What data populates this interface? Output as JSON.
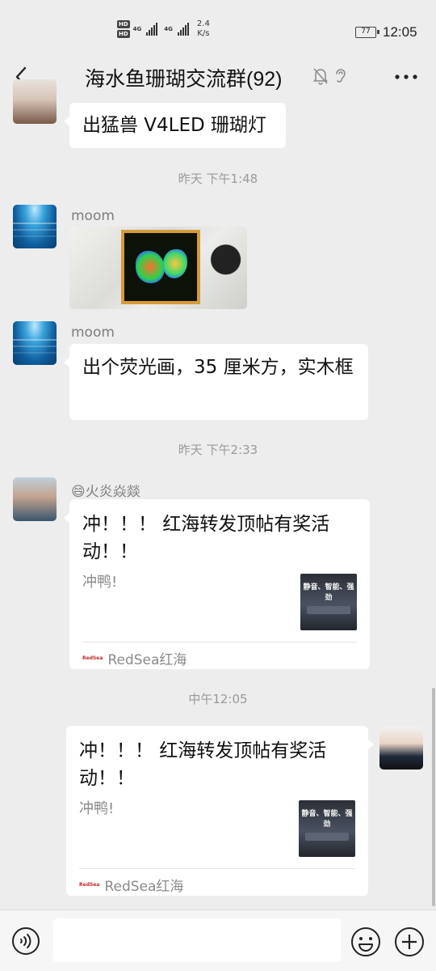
{
  "status_bar": {
    "hd1": "HD",
    "hd2": "HD",
    "sig1_label": "4G",
    "sig2_label": "4G",
    "speed_value": "2.4",
    "speed_unit": "K/s",
    "battery": "77",
    "time": "12:05"
  },
  "header": {
    "title": "海水鱼珊瑚交流群(92)"
  },
  "messages": {
    "m1_text": "出猛兽 V4LED 珊瑚灯",
    "time1": "昨天 下午1:48",
    "m2_sender": "moom",
    "m3_sender": "moom",
    "m3_text": "出个荧光画，35 厘米方，实木框",
    "time2": "昨天 下午2:33",
    "m4_sender": "😄火炎焱燚",
    "m4_card_title": "冲！！！ 红海转发顶帖有奖活动！！",
    "m4_card_desc": "冲鸭!",
    "m4_thumb_text": "静音、智能、强劲",
    "m4_source_logo": "RedSea",
    "m4_source": "RedSea红海",
    "time3": "中午12:05",
    "m5_card_title": "冲！！！ 红海转发顶帖有奖活动！！",
    "m5_card_desc": "冲鸭!",
    "m5_thumb_text": "静音、智能、强劲",
    "m5_source_logo": "RedSea",
    "m5_source": "RedSea红海"
  },
  "colors": {
    "background": "#ededed",
    "bubble": "#ffffff",
    "accent_red": "#c0282e"
  },
  "icons": {
    "back": "chevron-left-icon",
    "mute": "bell-muted-icon",
    "ear": "ear-icon",
    "more": "more-dots-icon",
    "voice": "voice-icon",
    "emoji": "emoji-icon",
    "plus": "plus-icon"
  }
}
